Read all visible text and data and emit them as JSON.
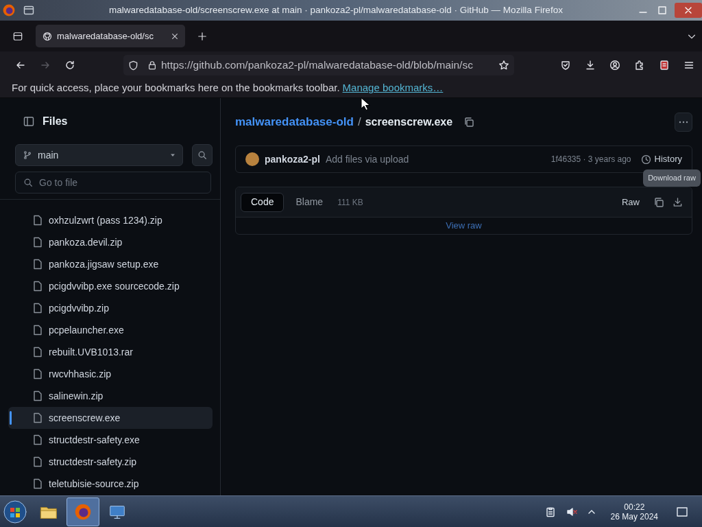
{
  "window": {
    "title": "malwaredatabase-old/screenscrew.exe at main · pankoza2-pl/malwaredatabase-old · GitHub — Mozilla Firefox"
  },
  "tabs": [
    {
      "label": "malwaredatabase-old/sc",
      "selected": true
    }
  ],
  "nav_buttons": [
    {
      "kind": "back",
      "disabled": false
    },
    {
      "kind": "forward",
      "disabled": true
    },
    {
      "kind": "reload",
      "disabled": false
    }
  ],
  "address_bar": {
    "url": "https://github.com/pankoza2-pl/malwaredatabase-old/blob/main/sc"
  },
  "bookmarks_bar": {
    "message": "For quick access, place your bookmarks here on the bookmarks toolbar.",
    "link": "Manage bookmarks…"
  },
  "sidebar": {
    "title": "Files",
    "branch": "main",
    "search": {
      "placeholder": "Go to file"
    },
    "items": [
      {
        "label": "oxhzulzwrt (pass 1234).zip",
        "selected": false
      },
      {
        "label": "pankoza.devil.zip",
        "selected": false
      },
      {
        "label": "pankoza.jigsaw setup.exe",
        "selected": false
      },
      {
        "label": "pcigdvvibp.exe sourcecode.zip",
        "selected": false
      },
      {
        "label": "pcigdvvibp.zip",
        "selected": false
      },
      {
        "label": "pcpelauncher.exe",
        "selected": false
      },
      {
        "label": "rebuilt.UVB1013.rar",
        "selected": false
      },
      {
        "label": "rwcvhhasic.zip",
        "selected": false
      },
      {
        "label": "salinewin.zip",
        "selected": false
      },
      {
        "label": "screenscrew.exe",
        "selected": true
      },
      {
        "label": "structdestr-safety.exe",
        "selected": false
      },
      {
        "label": "structdestr-safety.zip",
        "selected": false
      },
      {
        "label": "teletubisie-source.zip",
        "selected": false
      }
    ]
  },
  "breadcrumb": {
    "repo": "malwaredatabase-old",
    "separator": "/",
    "file": "screenscrew.exe"
  },
  "commit": {
    "author": "pankoza2-pl",
    "message": "Add files via upload",
    "meta": "1f46335 · 3 years ago",
    "history": "History"
  },
  "tooltip": "Download raw",
  "file_view": {
    "tabs": [
      {
        "label": "Code",
        "selected": true
      },
      {
        "label": "Blame",
        "selected": false
      }
    ],
    "size": "111 KB",
    "raw": "Raw",
    "view_raw": "View raw"
  },
  "taskbar": {
    "apps": [
      {
        "kind": "folder",
        "active": false
      },
      {
        "kind": "browser",
        "active": true
      },
      {
        "kind": "monitor",
        "active": false
      }
    ],
    "clock": {
      "time": "00:22",
      "date": "26 May 2024"
    }
  }
}
